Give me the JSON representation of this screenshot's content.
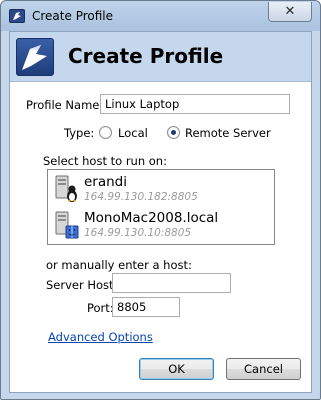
{
  "window": {
    "title": "Create Profile",
    "close_glyph": "✕"
  },
  "header": {
    "title": "Create Profile",
    "logo_icon": "profile-logo"
  },
  "form": {
    "profile_name_label": "Profile Name:",
    "profile_name_value": "Linux Laptop",
    "type_label": "Type:",
    "type_options": [
      {
        "label": "Local",
        "selected": false
      },
      {
        "label": "Remote Server",
        "selected": true
      }
    ],
    "select_host_label": "Select host to run on:",
    "hosts": [
      {
        "name": "erandi",
        "address": "164.99.130.182:8805",
        "os_icon": "linux-tux-icon"
      },
      {
        "name": "MonoMac2008.local",
        "address": "164.99.130.10:8805",
        "os_icon": "mac-finder-icon"
      }
    ],
    "manual_label": "or manually enter a host:",
    "server_host_label": "Server Host:",
    "server_host_value": "",
    "port_label": "Port:",
    "port_value": "8805",
    "advanced_link": "Advanced Options"
  },
  "buttons": {
    "ok": "OK",
    "cancel": "Cancel"
  },
  "colors": {
    "title_bar": "#bfd3ea",
    "header_band": "#c4d7ec",
    "link": "#0645ad"
  }
}
